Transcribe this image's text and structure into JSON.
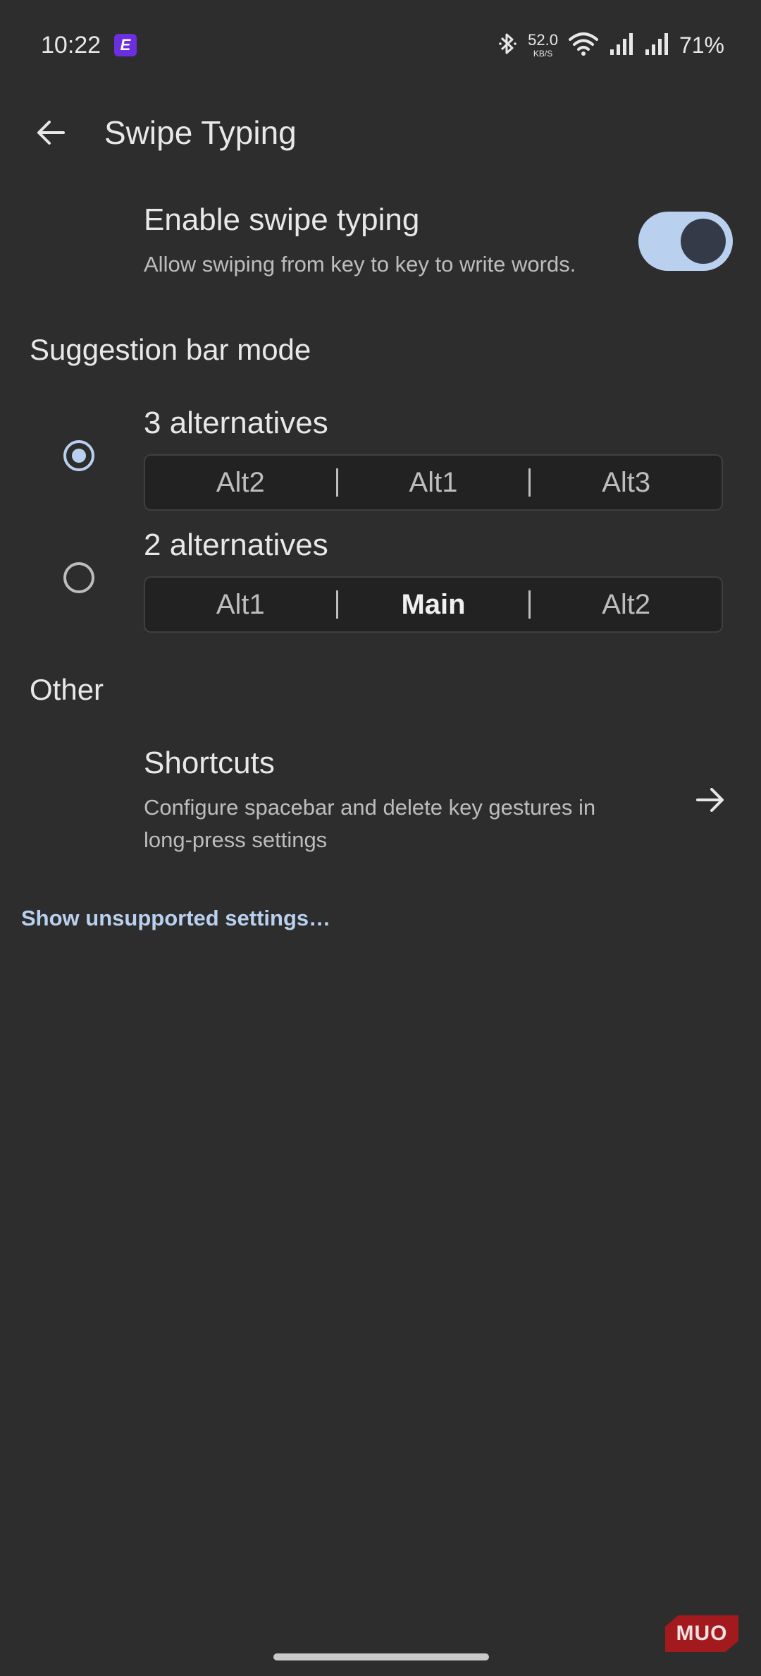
{
  "status_bar": {
    "time": "10:22",
    "app_icon_letter": "E",
    "net_speed": "52.0",
    "net_speed_unit": "KB/S",
    "battery": "71%",
    "icons": [
      "bluetooth-icon",
      "wifi-icon",
      "signal-icon",
      "signal-icon"
    ]
  },
  "header": {
    "title": "Swipe Typing",
    "back_icon": "arrow-left-icon"
  },
  "enable_swipe": {
    "title": "Enable swipe typing",
    "summary": "Allow swiping from key to key to write words.",
    "enabled": true
  },
  "suggestion_bar": {
    "header": "Suggestion bar mode",
    "options": [
      {
        "title": "3 alternatives",
        "selected": true,
        "cells": [
          "Alt2",
          "Alt1",
          "Alt3"
        ],
        "bold_index": -1
      },
      {
        "title": "2 alternatives",
        "selected": false,
        "cells": [
          "Alt1",
          "Main",
          "Alt2"
        ],
        "bold_index": 1
      }
    ]
  },
  "other": {
    "header": "Other",
    "shortcuts_title": "Shortcuts",
    "shortcuts_summary_line1": "Configure spacebar and delete key gestures in",
    "shortcuts_summary_line2": "long-press settings",
    "chevron_icon": "arrow-right-icon"
  },
  "footer_link": "Show unsupported settings…",
  "watermark": "MUO",
  "colors": {
    "background": "#2d2d2d",
    "accent": "#b9d0ef",
    "text_primary": "#e8e8e8",
    "text_secondary": "#bdbdbd"
  }
}
